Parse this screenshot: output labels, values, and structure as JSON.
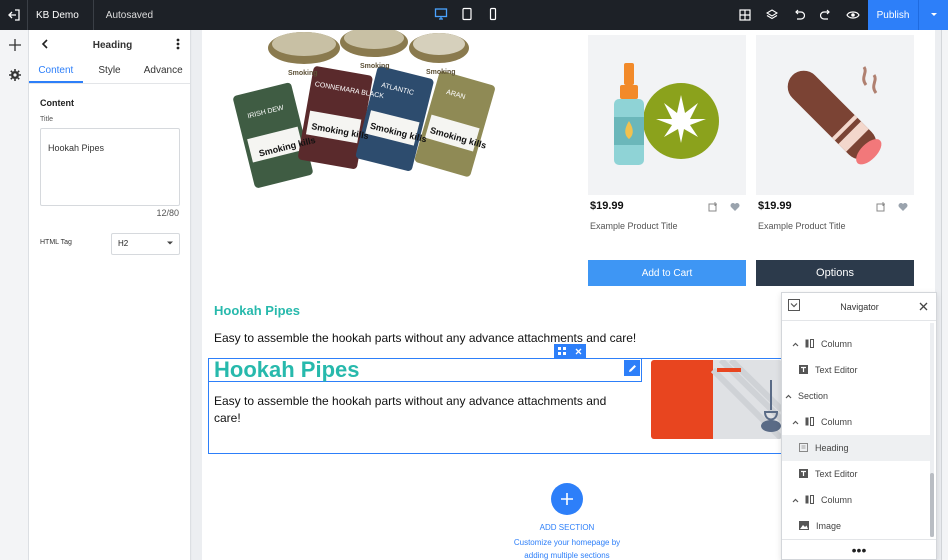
{
  "topbar": {
    "project": "KB Demo",
    "status": "Autosaved",
    "publish_label": "Publish"
  },
  "panel": {
    "title": "Heading",
    "tabs": [
      "Content",
      "Style",
      "Advance"
    ],
    "section_label": "Content",
    "title_field_label": "Title",
    "title_value": "Hookah Pipes",
    "char_counter": "12/80",
    "html_tag_label": "HTML Tag",
    "html_tag_value": "H2"
  },
  "products": [
    {
      "price": "$19.99",
      "title": "Example Product Title"
    },
    {
      "price": "$19.99",
      "title": "Example Product Title"
    }
  ],
  "buttons": {
    "add_to_cart": "Add to Cart",
    "options": "Options"
  },
  "content": {
    "small_heading": "Hookah Pipes",
    "paragraph_1": "Easy to assemble the hookah parts without any advance attachments and care!",
    "big_heading": "Hookah Pipes",
    "paragraph_2_line1": "Easy to assemble the hookah parts without any advance attachments and",
    "paragraph_2_line2": "care!"
  },
  "tins": {
    "labels": [
      "Smoking",
      "Smoking",
      "Smoking",
      "Smoking kills",
      "Smoking kills",
      "Smoking kills",
      "Smoking kills"
    ],
    "brands": [
      "IRISH DEW",
      "CONNEMARA BLACK",
      "ATLANTIC",
      "ARAN"
    ]
  },
  "add_section": {
    "label": "ADD SECTION",
    "sub_line1": "Customize your homepage by",
    "sub_line2": "adding multiple sections"
  },
  "navigator": {
    "title": "Navigator",
    "items": [
      "Column",
      "Text Editor",
      "Section",
      "Column",
      "Heading",
      "Text Editor",
      "Column",
      "Image"
    ],
    "more": "•••"
  },
  "colors": {
    "accent": "#2d7ff9",
    "heading_teal": "#27b9ac",
    "topbar_bg": "#1d2127",
    "options_btn": "#2c3a4b"
  }
}
